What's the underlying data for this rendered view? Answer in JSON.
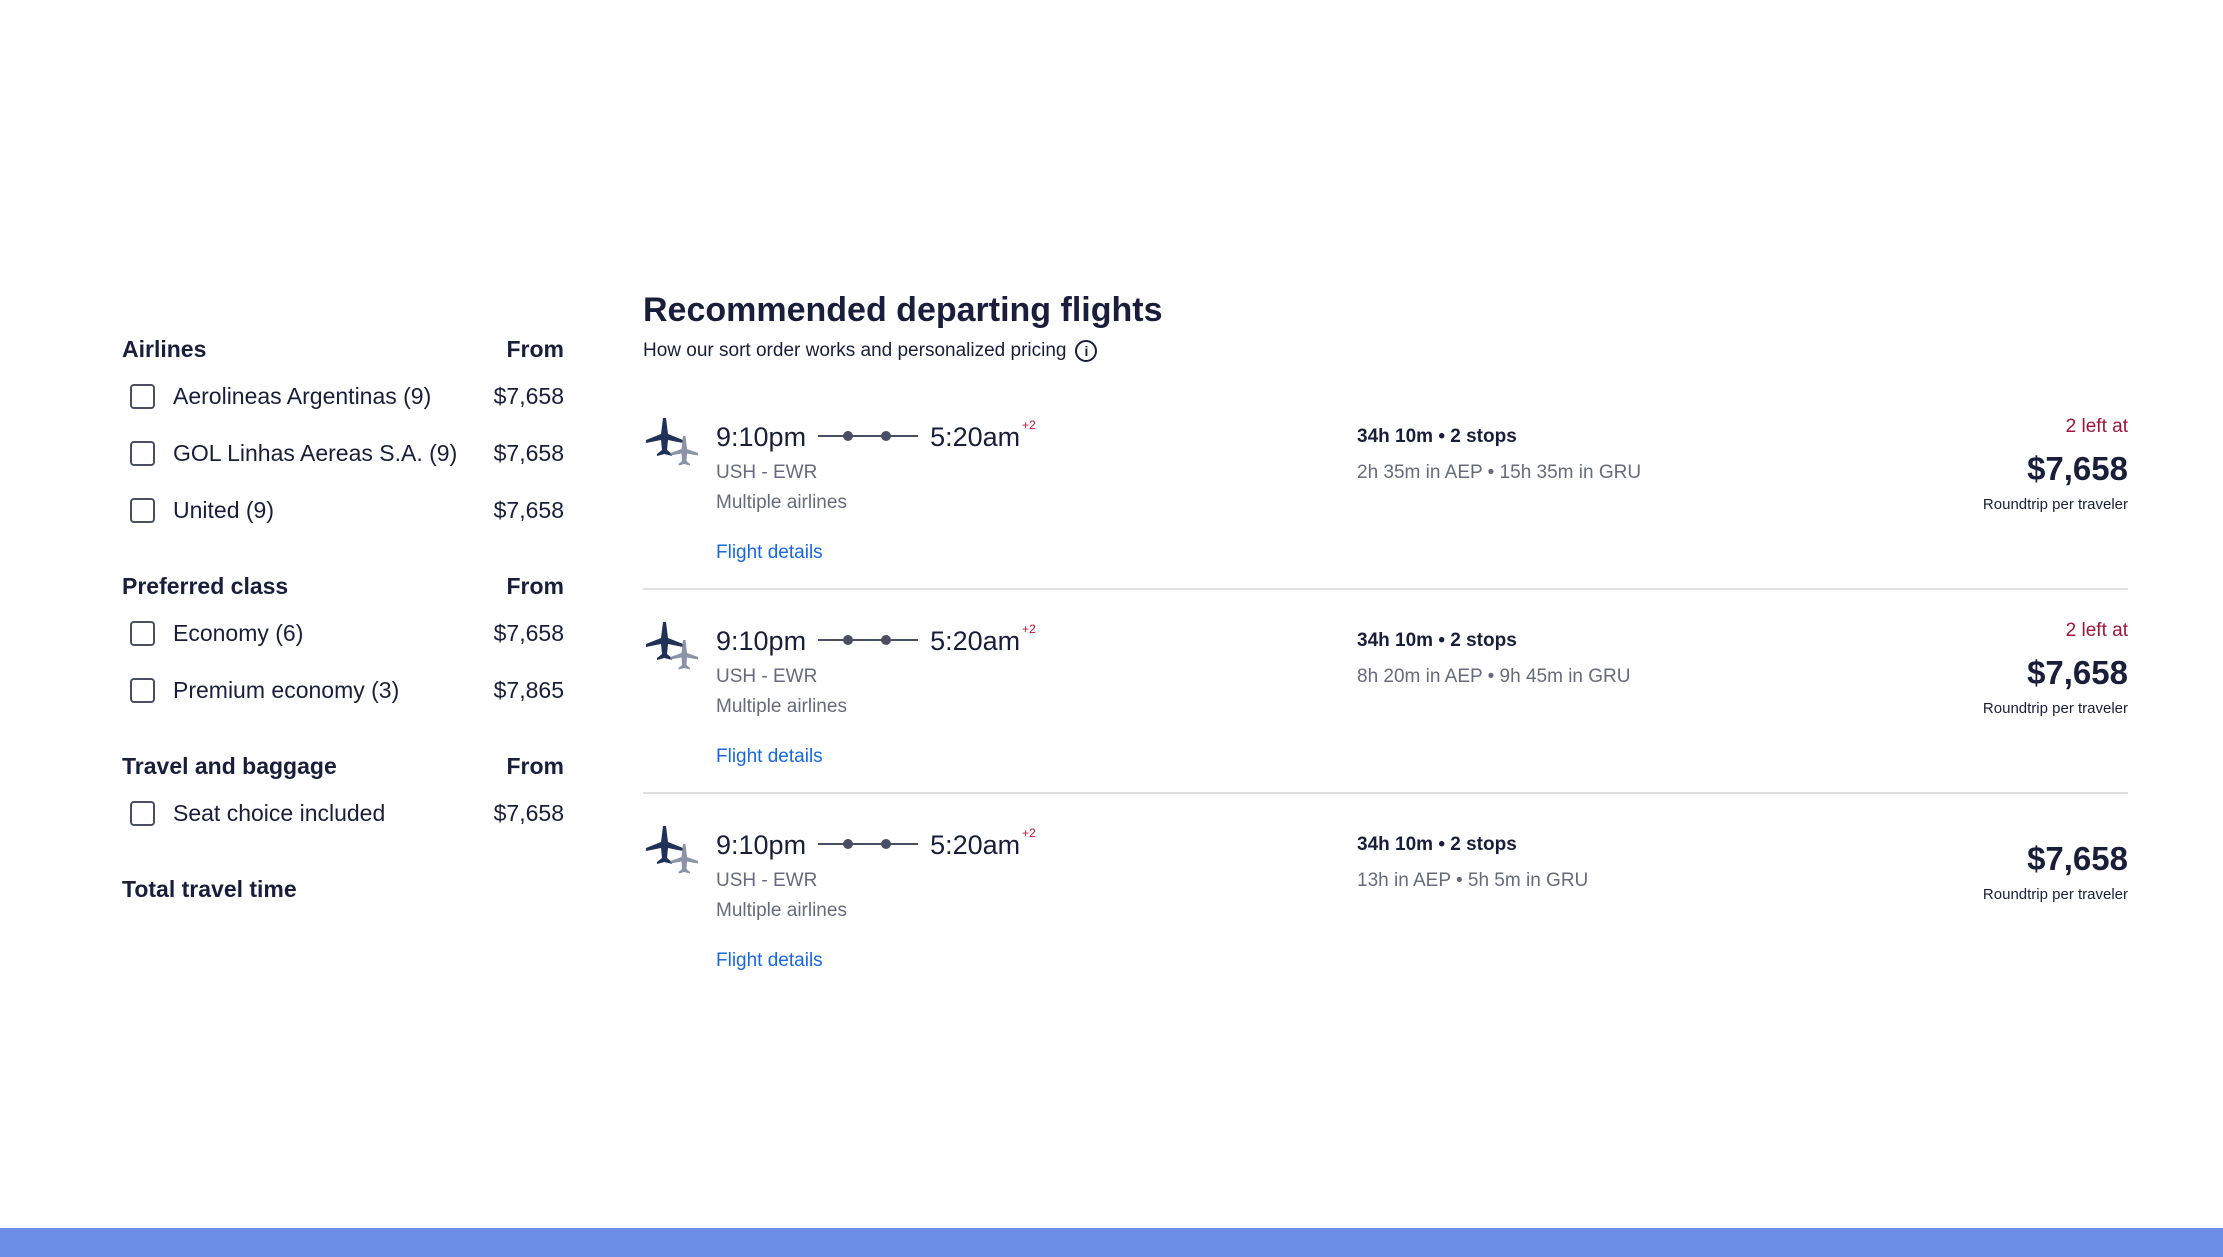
{
  "filters": {
    "airlines": {
      "title": "Airlines",
      "from_label": "From",
      "items": [
        {
          "label": "Aerolineas Argentinas (9)",
          "price": "$7,658"
        },
        {
          "label": "GOL Linhas Aereas S.A. (9)",
          "price": "$7,658"
        },
        {
          "label": "United (9)",
          "price": "$7,658"
        }
      ]
    },
    "preferred_class": {
      "title": "Preferred class",
      "from_label": "From",
      "items": [
        {
          "label": "Economy (6)",
          "price": "$7,658"
        },
        {
          "label": "Premium economy (3)",
          "price": "$7,865"
        }
      ]
    },
    "travel_baggage": {
      "title": "Travel and baggage",
      "from_label": "From",
      "items": [
        {
          "label": "Seat choice included",
          "price": "$7,658"
        }
      ]
    },
    "total_travel_time": {
      "title": "Total travel time"
    }
  },
  "results": {
    "title": "Recommended departing flights",
    "sort_note": "How our sort order works and personalized pricing",
    "info_icon": "info-circle-icon",
    "flights": [
      {
        "depart": "9:10pm",
        "arrive": "5:20am",
        "plus_days": "+2",
        "airports": "USH - EWR",
        "airlines": "Multiple airlines",
        "details_link": "Flight details",
        "duration": "34h 10m • 2 stops",
        "stops": "2h 35m in AEP • 15h 35m in GRU",
        "seats_left": "2 left at",
        "price": "$7,658",
        "price_note": "Roundtrip per traveler"
      },
      {
        "depart": "9:10pm",
        "arrive": "5:20am",
        "plus_days": "+2",
        "airports": "USH - EWR",
        "airlines": "Multiple airlines",
        "details_link": "Flight details",
        "duration": "34h 10m • 2 stops",
        "stops": "8h 20m in AEP • 9h 45m in GRU",
        "seats_left": "2 left at",
        "price": "$7,658",
        "price_note": "Roundtrip per traveler"
      },
      {
        "depart": "9:10pm",
        "arrive": "5:20am",
        "plus_days": "+2",
        "airports": "USH - EWR",
        "airlines": "Multiple airlines",
        "details_link": "Flight details",
        "duration": "34h 10m • 2 stops",
        "stops": "13h in AEP • 5h 5m in GRU",
        "seats_left": "",
        "price": "$7,658",
        "price_note": "Roundtrip per traveler"
      }
    ]
  },
  "colors": {
    "text_primary": "#191e3b",
    "text_secondary": "#676a7d",
    "link": "#1668e3",
    "urgency": "#a0143c",
    "plus_days": "#c8102e",
    "bottom_bar": "#6d8ee6"
  }
}
